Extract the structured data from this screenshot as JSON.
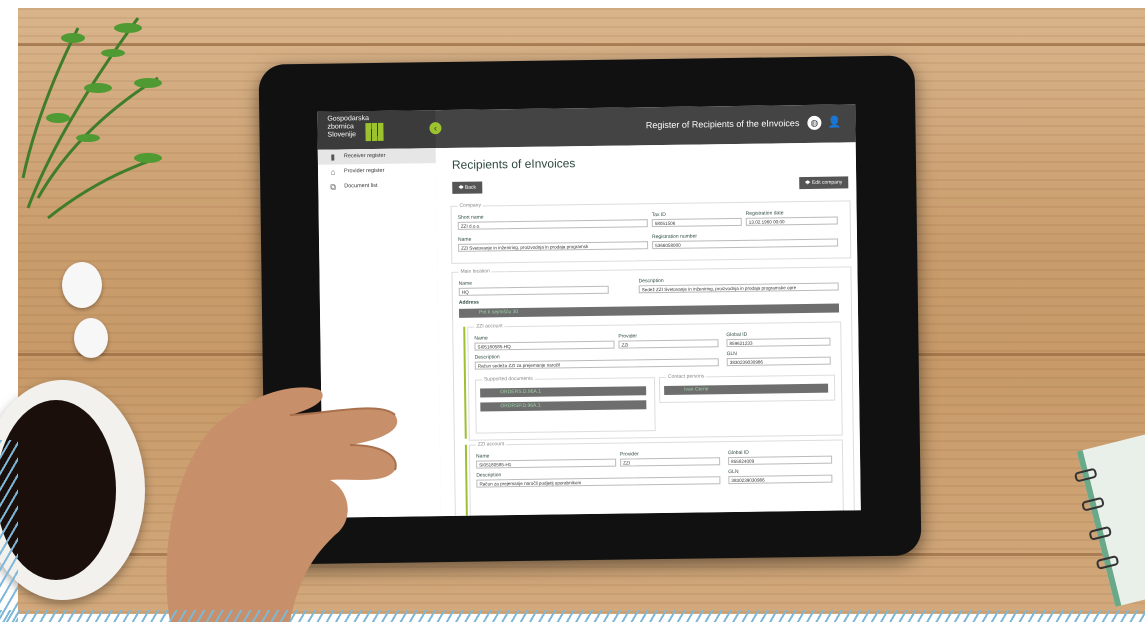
{
  "header": {
    "logo_line1": "Gospodarska",
    "logo_line2": "zbornica",
    "logo_line3": "Slovenije",
    "app_title": "Register of Recipients of the eInvoices"
  },
  "sidebar": {
    "items": [
      {
        "label": "Receiver register",
        "icon": "book-icon",
        "active": true
      },
      {
        "label": "Provider register",
        "icon": "bank-icon",
        "active": false
      },
      {
        "label": "Document list",
        "icon": "documents-icon",
        "active": false
      }
    ]
  },
  "main": {
    "title": "Recipients of eInvoices",
    "back_label": "Back",
    "edit_label": "Edit company",
    "company": {
      "legend": "Company",
      "short_name_label": "Short name",
      "short_name": "ZZI d.o.o.",
      "tax_id_label": "Tax ID",
      "tax_id": "58051506",
      "reg_date_label": "Registration date",
      "reg_date": "13.02.1960 00:00",
      "name_label": "Name",
      "name": "ZZI Svetovanje in inženiring, proizvodnja in prodaja programsk",
      "reg_number_label": "Registration number",
      "reg_number": "5366058000"
    },
    "location": {
      "legend": "Main location",
      "name_label": "Name",
      "name": "HQ",
      "desc_label": "Description",
      "desc": "Sedež ZZI Svetovanje in inženiring, proizvodnja in prodaja programske opre",
      "address_label": "Address",
      "address": "Pot k sejmišču 30"
    },
    "account1": {
      "legend": "ZZI account",
      "name_label": "Name",
      "name": "SI05180585-HQ",
      "provider_label": "Provider",
      "provider": "ZZI",
      "global_id_label": "Global ID",
      "global_id": "859621233",
      "desc_label": "Description",
      "desc": "Račun sedeža ZZI za prejemanje naročil",
      "gln_label": "GLN",
      "gln": "3830239030986",
      "supported_legend": "Supported documents",
      "doc1": "ORDERS.D.96A.1",
      "doc2": "ORDRSP.D.96A.1",
      "contact_legend": "Contact persons",
      "contact1": "Ivan Cerne"
    },
    "account2": {
      "legend": "ZZI account",
      "name_label": "Name",
      "name": "SI05180585-H1",
      "provider_label": "Provider",
      "provider": "ZZI",
      "global_id_label": "Global ID",
      "global_id": "855624009",
      "desc_label": "Description",
      "desc": "Račun za prejemanje naročil podjetij uporabnikom",
      "gln_label": "GLN",
      "gln": "3830239030986"
    }
  },
  "colors": {
    "accent": "#9cc22f",
    "topbar": "#444444",
    "title": "#2f4a3f"
  }
}
